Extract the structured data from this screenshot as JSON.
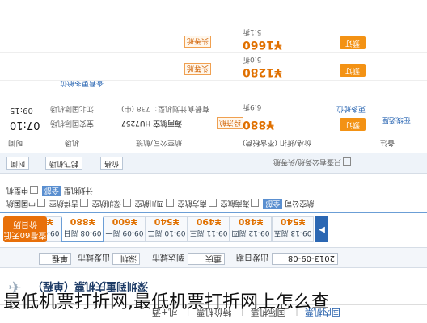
{
  "nav": {
    "items": [
      "国内机票",
      "国际机票",
      "特价机票",
      "机+酒"
    ]
  },
  "route_title": "深圳到重庆机票（单程）",
  "search": {
    "type_label": "单程",
    "depart_label": "出发城市",
    "depart_value": "深圳",
    "arrive_label": "到达城市",
    "arrive_value": "重庆",
    "date_label": "出发日期",
    "date_value": "2013-09-08"
  },
  "date_tabs": [
    {
      "date": "09-07 周六",
      "price": "¥730"
    },
    {
      "date": "09-08 周日",
      "price": "¥880"
    },
    {
      "date": "09-09 周一",
      "price": "¥600"
    },
    {
      "date": "09-10 周二",
      "price": "¥540"
    },
    {
      "date": "09-11 周三",
      "price": "¥490"
    },
    {
      "date": "09-12 周四",
      "price": "¥480"
    },
    {
      "date": "09-13 周五",
      "price": "¥540"
    }
  ],
  "calendar_label": "查看60天低价日历",
  "filters": {
    "airline_label": "航空公司",
    "all_label": "全部",
    "airlines": [
      "海南航空",
      "南方航空",
      "四川航空",
      "深圳航空",
      "吉祥航空",
      "中国国航"
    ],
    "plan_label": "计划机型",
    "plan_all": "全部",
    "plan_mid": "中型机"
  },
  "sortbar": {
    "time": "时间",
    "depart_airport": "起飞机场",
    "price": "价格",
    "check_label": "只查看公务舱/头等舱"
  },
  "header": {
    "time": "时间",
    "airport": "机场",
    "airline": "航空公司/航班",
    "price": "价格/折扣 (不含税费)",
    "note": "备注"
  },
  "flights": [
    {
      "dep_time": "07:10",
      "arr_time": "09:15",
      "dep_airport": "宝安国际机场",
      "arr_airport": "江北国际机场",
      "airline": "海南航空 HU7257",
      "plane": "计划机型：738 (中)",
      "meal": "有餐食",
      "price": "¥880",
      "discount": "6.9折",
      "tag": "经济舱",
      "book": "预订",
      "more": "更多舱位",
      "extra": "在线选座"
    },
    {
      "price": "¥1280",
      "discount": "5.0折",
      "tag": "头等舱",
      "book": "预订"
    },
    {
      "price": "¥1660",
      "discount": "5.1折",
      "tag": "头等舱",
      "book": "预订"
    }
  ],
  "more_link": "查看更多舱位",
  "caption": "最低机票打折网,最低机票打折网上怎么查"
}
